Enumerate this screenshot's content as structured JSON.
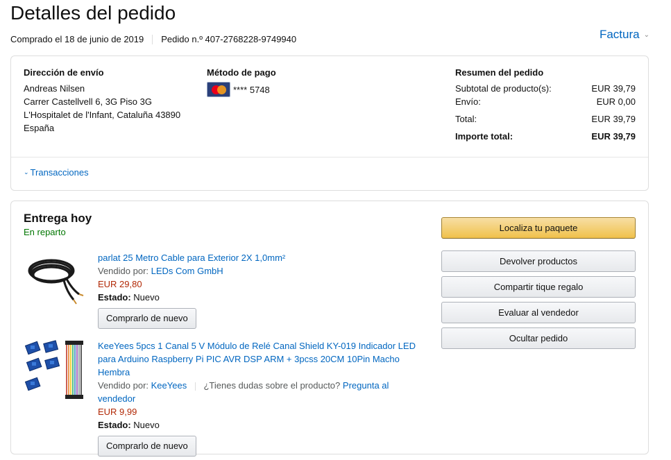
{
  "header": {
    "title": "Detalles del pedido",
    "purchased": "Comprado el 18 de junio de 2019",
    "order_number": "Pedido n.º 407-2768228-9749940",
    "invoice_label": "Factura"
  },
  "shipping": {
    "heading": "Dirección de envío",
    "lines": [
      "Andreas Nilsen",
      "Carrer Castellvell 6, 3G Piso 3G",
      "L'Hospitalet de l'Infant, Cataluña 43890",
      "España"
    ]
  },
  "payment": {
    "heading": "Método de pago",
    "card_icon": "mastercard-icon",
    "card_text": "**** 5748"
  },
  "summary": {
    "heading": "Resumen del pedido",
    "subtotal_label": "Subtotal de producto(s):",
    "subtotal_value": "EUR 39,79",
    "shipping_label": "Envío:",
    "shipping_value": "EUR 0,00",
    "total_label": "Total:",
    "total_value": "EUR 39,79",
    "grand_label": "Importe total:",
    "grand_value": "EUR 39,79"
  },
  "transactions_label": "Transacciones",
  "delivery": {
    "title": "Entrega hoy",
    "status": "En reparto"
  },
  "items": [
    {
      "title": "parlat 25 Metro Cable para Exterior 2X 1,0mm²",
      "sold_by_label": "Vendido por:",
      "seller": "LEDs Com GmbH",
      "price": "EUR 29,80",
      "state_label": "Estado:",
      "state": "Nuevo",
      "buy_again": "Comprarlo de nuevo"
    },
    {
      "title": "KeeYees 5pcs 1 Canal 5 V Módulo de Relé Canal Shield KY-019 Indicador LED para Arduino Raspberry Pi PIC AVR DSP ARM + 3pcss 20CM 10Pin Macho Hembra",
      "sold_by_label": "Vendido por:",
      "seller": "KeeYees",
      "question": "¿Tienes dudas sobre el producto?",
      "ask_seller": "Pregunta al vendedor",
      "price": "EUR 9,99",
      "state_label": "Estado:",
      "state": "Nuevo",
      "buy_again": "Comprarlo de nuevo"
    }
  ],
  "actions": {
    "track": "Localiza tu paquete",
    "return": "Devolver productos",
    "gift_receipt": "Compartir tique regalo",
    "rate_seller": "Evaluar al vendedor",
    "hide_order": "Ocultar pedido"
  }
}
